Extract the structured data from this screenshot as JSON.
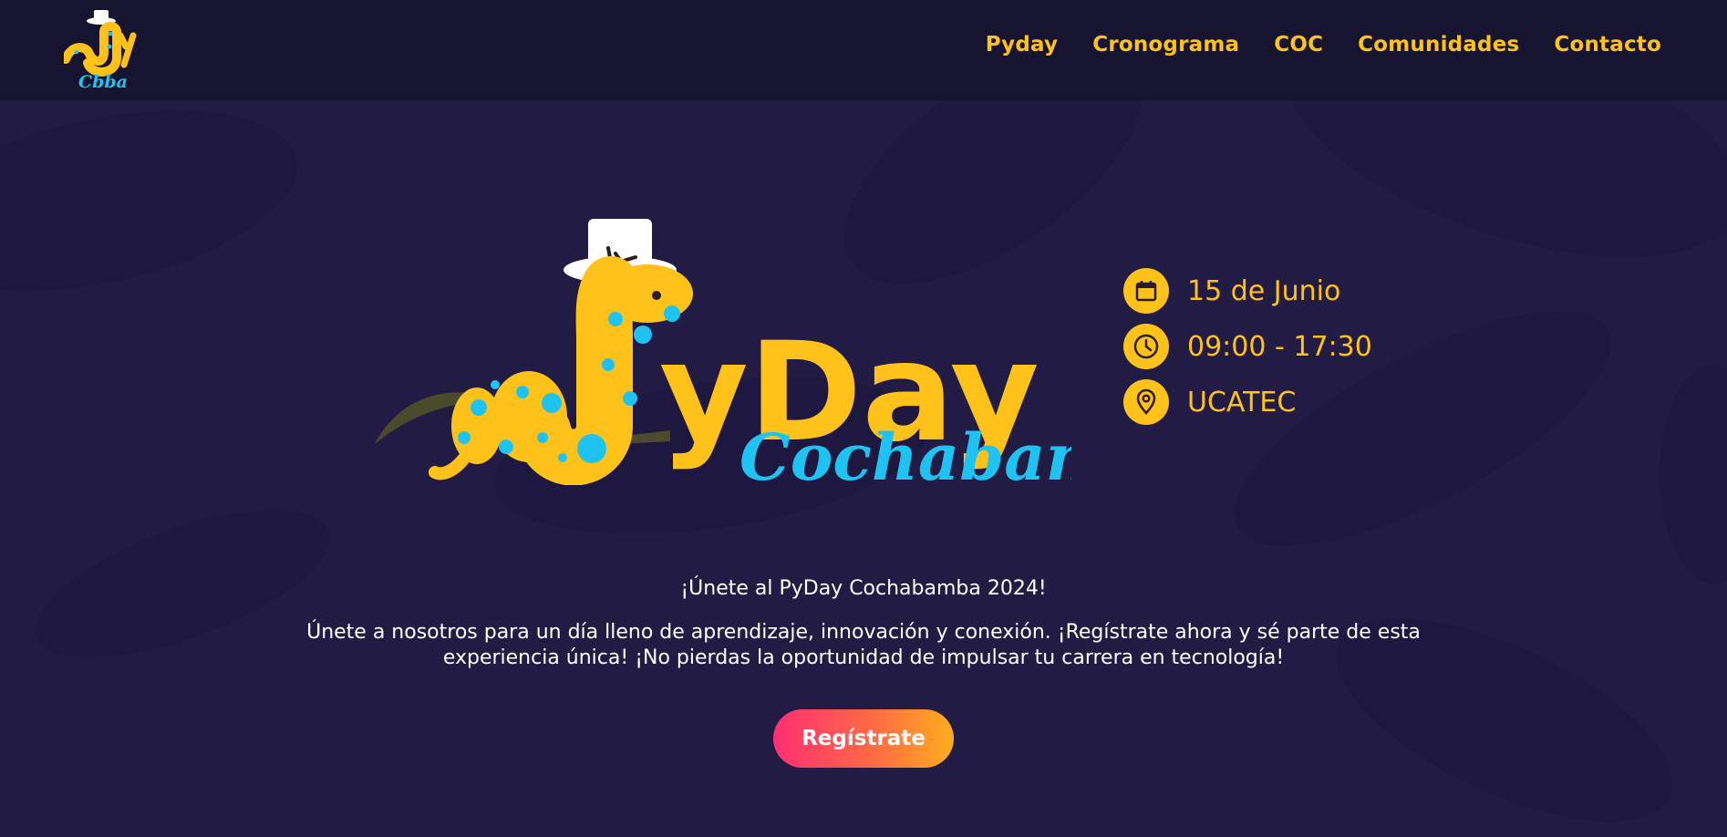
{
  "nav": {
    "logo_text": "Cbba",
    "items": [
      {
        "label": "Pyday"
      },
      {
        "label": "Cronograma"
      },
      {
        "label": "COC"
      },
      {
        "label": "Comunidades"
      },
      {
        "label": "Contacto"
      }
    ]
  },
  "hero": {
    "logo_title": "yDay",
    "logo_subtitle": "Cochabamba"
  },
  "event_info": {
    "date": {
      "text": "15 de Junio",
      "icon": "calendar-icon"
    },
    "time": {
      "text": "09:00 - 17:30",
      "icon": "clock-icon"
    },
    "location": {
      "text": "UCATEC",
      "icon": "location-pin-icon"
    }
  },
  "content": {
    "heading": "¡Únete al PyDay Cochabamba 2024!",
    "description": "Únete a nosotros para un día lleno de aprendizaje, innovación y conexión. ¡Regístrate ahora y sé parte de esta experiencia única! ¡No pierdas la oportunidad de impulsar tu carrera en tecnología!"
  },
  "cta": {
    "label": "Regístrate"
  },
  "colors": {
    "background": "#221c45",
    "header": "#17142f",
    "accent_yellow": "#ffc21b",
    "accent_blue": "#1fc3f2",
    "cta_gradient_start": "#ff2e72",
    "cta_gradient_end": "#ffae1e"
  }
}
